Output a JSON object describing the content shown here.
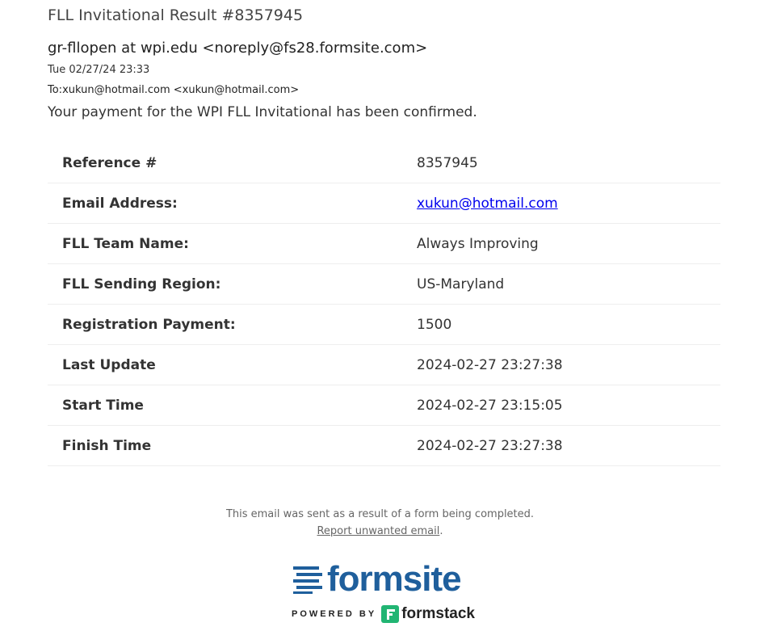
{
  "email": {
    "subject": "FLL Invitational Result #8357945",
    "sender": "gr-fllopen at wpi.edu <noreply@fs28.formsite.com>",
    "date": "Tue 02/27/24 23:33",
    "to": "To:xukun@hotmail.com <xukun@hotmail.com>",
    "intro": "Your payment for the WPI FLL Invitational has been confirmed."
  },
  "results": [
    {
      "label": "Reference #",
      "value": "8357945"
    },
    {
      "label": "Email Address:",
      "value": "xukun@hotmail.com"
    },
    {
      "label": "FLL Team Name:",
      "value": "Always Improving"
    },
    {
      "label": "FLL Sending Region:",
      "value": "US-Maryland"
    },
    {
      "label": "Registration Payment:",
      "value": "1500"
    },
    {
      "label": "Last Update",
      "value": "2024-02-27 23:27:38"
    },
    {
      "label": "Start Time",
      "value": "2024-02-27 23:15:05"
    },
    {
      "label": "Finish Time",
      "value": "2024-02-27 23:27:38"
    }
  ],
  "footer": {
    "note": "This email was sent as a result of a form being completed.",
    "report_link": "Report unwanted email",
    "report_suffix": "."
  },
  "branding": {
    "logo_text": "formsite",
    "powered_by": "POWERED BY",
    "partner_text": "formstack",
    "logo_icon": "formsite-lines-icon",
    "partner_icon": "formstack-icon"
  },
  "colors": {
    "link": "#0000ee",
    "formsite_blue": "#1f5f9c",
    "formstack_green": "#21b573"
  }
}
